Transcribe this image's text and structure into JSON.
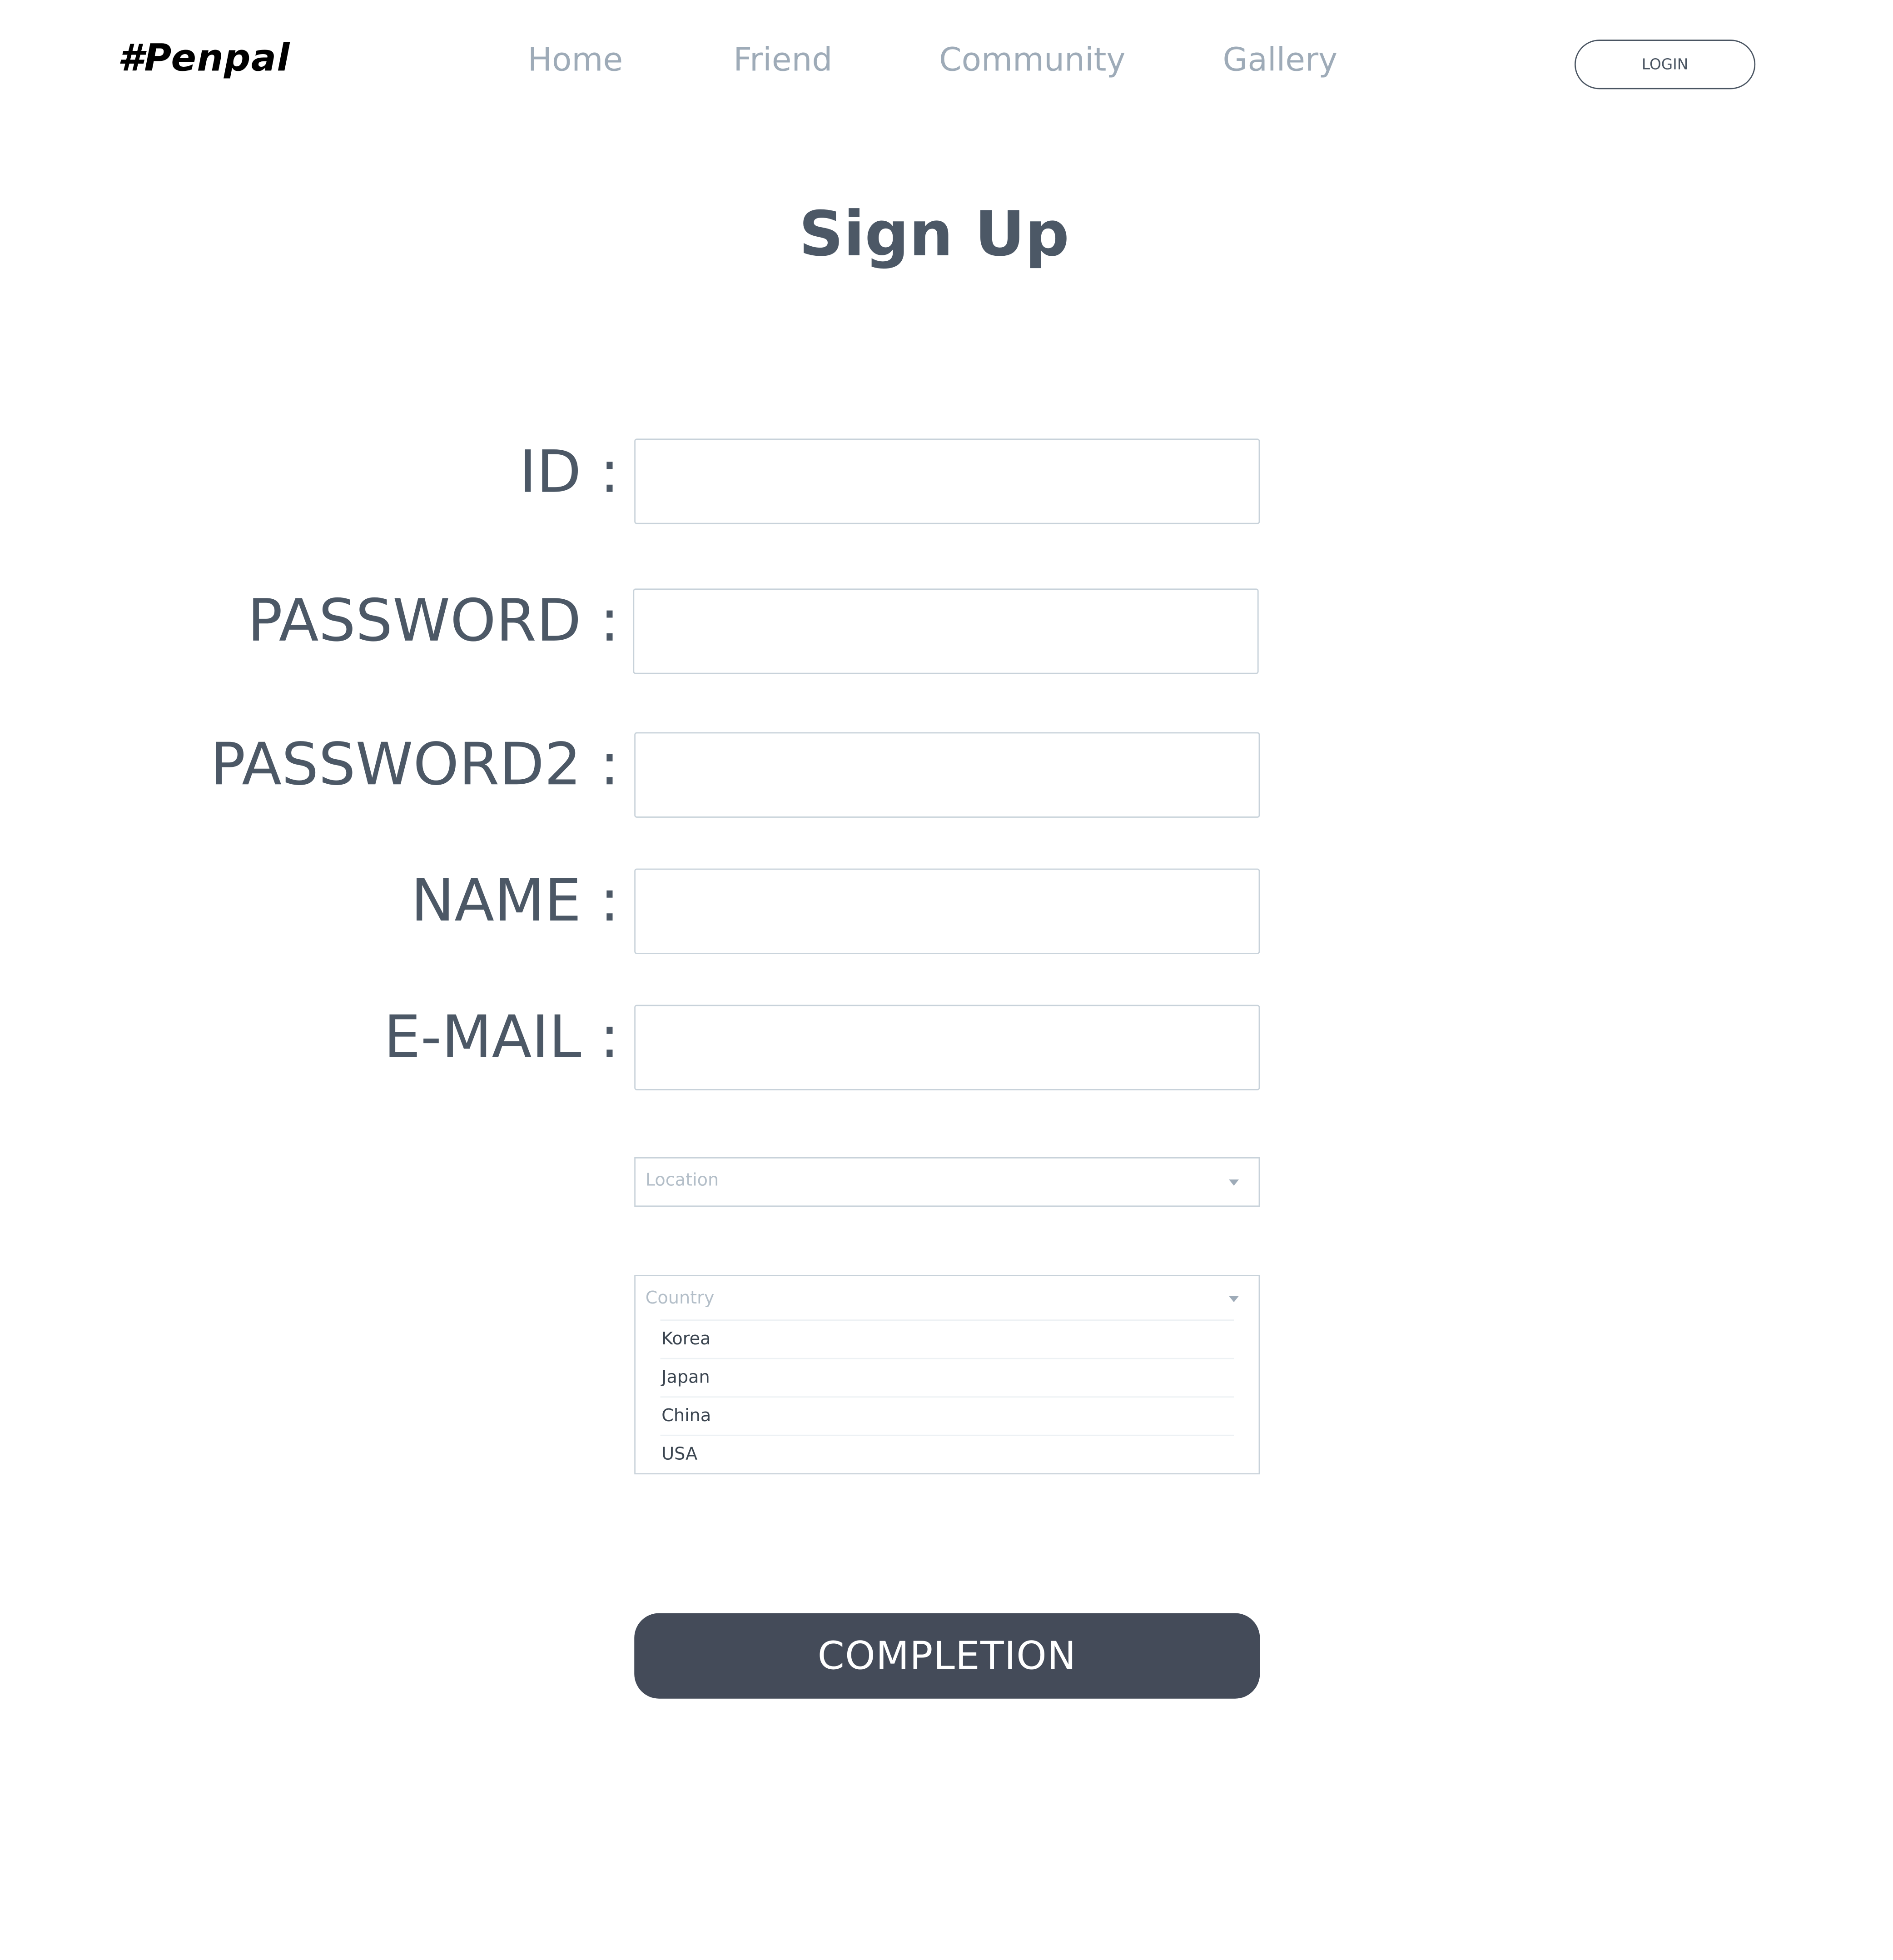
{
  "header": {
    "logo": "#Penpal",
    "nav": [
      {
        "label": "Home"
      },
      {
        "label": "Friend"
      },
      {
        "label": "Community"
      },
      {
        "label": "Gallery"
      }
    ],
    "login_label": "LOGIN"
  },
  "page": {
    "title": "Sign Up"
  },
  "form": {
    "fields": [
      {
        "label": "ID :",
        "value": ""
      },
      {
        "label": "PASSWORD :",
        "value": ""
      },
      {
        "label": "PASSWORD2 :",
        "value": ""
      },
      {
        "label": "NAME :",
        "value": ""
      },
      {
        "label": "E-MAIL :",
        "value": ""
      }
    ],
    "location": {
      "placeholder": "Location"
    },
    "country": {
      "placeholder": "Country",
      "expanded": true,
      "options": [
        "Korea",
        "Japan",
        "China",
        "USA"
      ]
    },
    "submit_label": "COMPLETION"
  },
  "colors": {
    "label_text": "#4c5866",
    "nav_text": "#9eabb8",
    "field_border": "#c8d2da",
    "button_bg": "#444b59",
    "button_text": "#ffffff"
  }
}
